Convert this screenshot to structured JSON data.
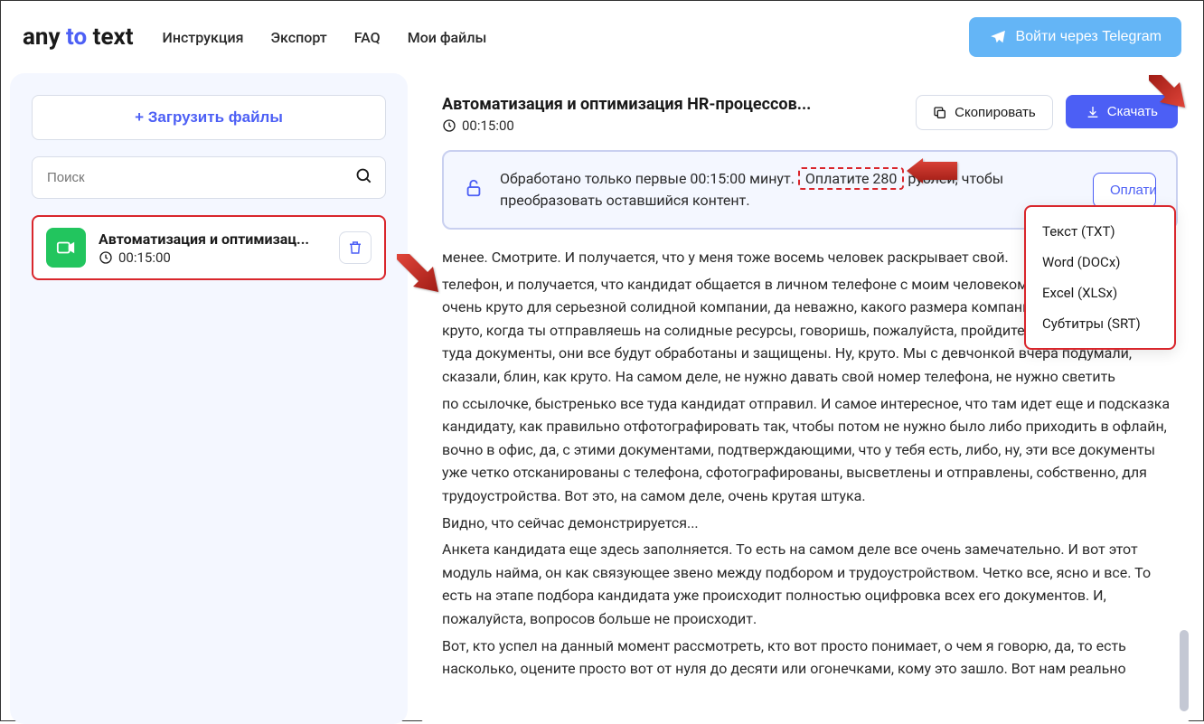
{
  "logo": {
    "any": "any",
    "to": " to ",
    "text": "text"
  },
  "nav": {
    "instructions": "Инструкция",
    "export": "Экспорт",
    "faq": "FAQ",
    "myfiles": "Мои файлы"
  },
  "header": {
    "telegram_btn": "Войти через Telegram"
  },
  "sidebar": {
    "upload_btn": "+  Загрузить файлы",
    "search_placeholder": "Поиск",
    "file": {
      "title": "Автоматизация и оптимизац...",
      "duration": "00:15:00"
    }
  },
  "main": {
    "title": "Автоматизация и оптимизация HR-процессов...",
    "duration": "00:15:00",
    "copy_btn": "Скопировать",
    "download_btn": "Скачать"
  },
  "banner": {
    "text_before": "Обработано только первые 00:15:00 минут. ",
    "highlight": "Оплатите 280",
    "text_after": " рублей, чтобы преобразовать оставшийся контент.",
    "pay_btn": "Оплатить"
  },
  "dropdown": {
    "txt": "Текст (TXT)",
    "docx": "Word (DOCx)",
    "xlsx": "Excel (XLSx)",
    "srt": "Субтитры (SRT)"
  },
  "transcript": {
    "p1": "менее. Смотрите. И получается, что у меня тоже восемь человек раскрывает свой.",
    "p2": "телефон, и получается, что кандидат общается в личном телефоне с моим человеком. На самом деле, не очень круто для серьезной солидной компании, да неважно, какого размера компания, в любом случае, круто, когда ты отправляешь на солидные ресурсы, говоришь, пожалуйста, пройдите по ссылке, скиньте туда документы, они все будут обработаны и защищены. Ну, круто. Мы с девчонкой вчера подумали, сказали, блин, как круто. На самом деле, не нужно давать свой номер телефона, не нужно светить",
    "p3": "по ссылочке, быстренько все туда кандидат отправил. И самое интересное, что там идет еще и подсказка кандидату, как правильно отфотографировать так, чтобы потом не нужно было либо приходить в офлайн, вочно в офис, да, с этими документами, подтверждающими, что у тебя есть, либо, ну, эти все документы уже четко отсканированы с телефона, сфотографированы, высветлены и отправлены, собственно, для трудоустройства. Вот это, на самом деле, очень крутая штука.",
    "p4": "Видно, что сейчас демонстрируется...",
    "p5": "Анкета кандидата еще здесь заполняется. То есть на самом деле все очень замечательно. И вот этот модуль найма, он как связующее звено между подбором и трудоустройством. Четко все, ясно и все. То есть на этапе подбора кандидата уже происходит полностью оцифровка всех его документов. И, пожалуйста, вопросов больше не происходит.",
    "p6": "Вот, кто успел на данный момент рассмотреть, кто вот просто понимает, о чем я говорю, да, то есть насколько, оцените просто вот от нуля до десяти или огонечками, кому это зашло. Вот нам реально"
  }
}
